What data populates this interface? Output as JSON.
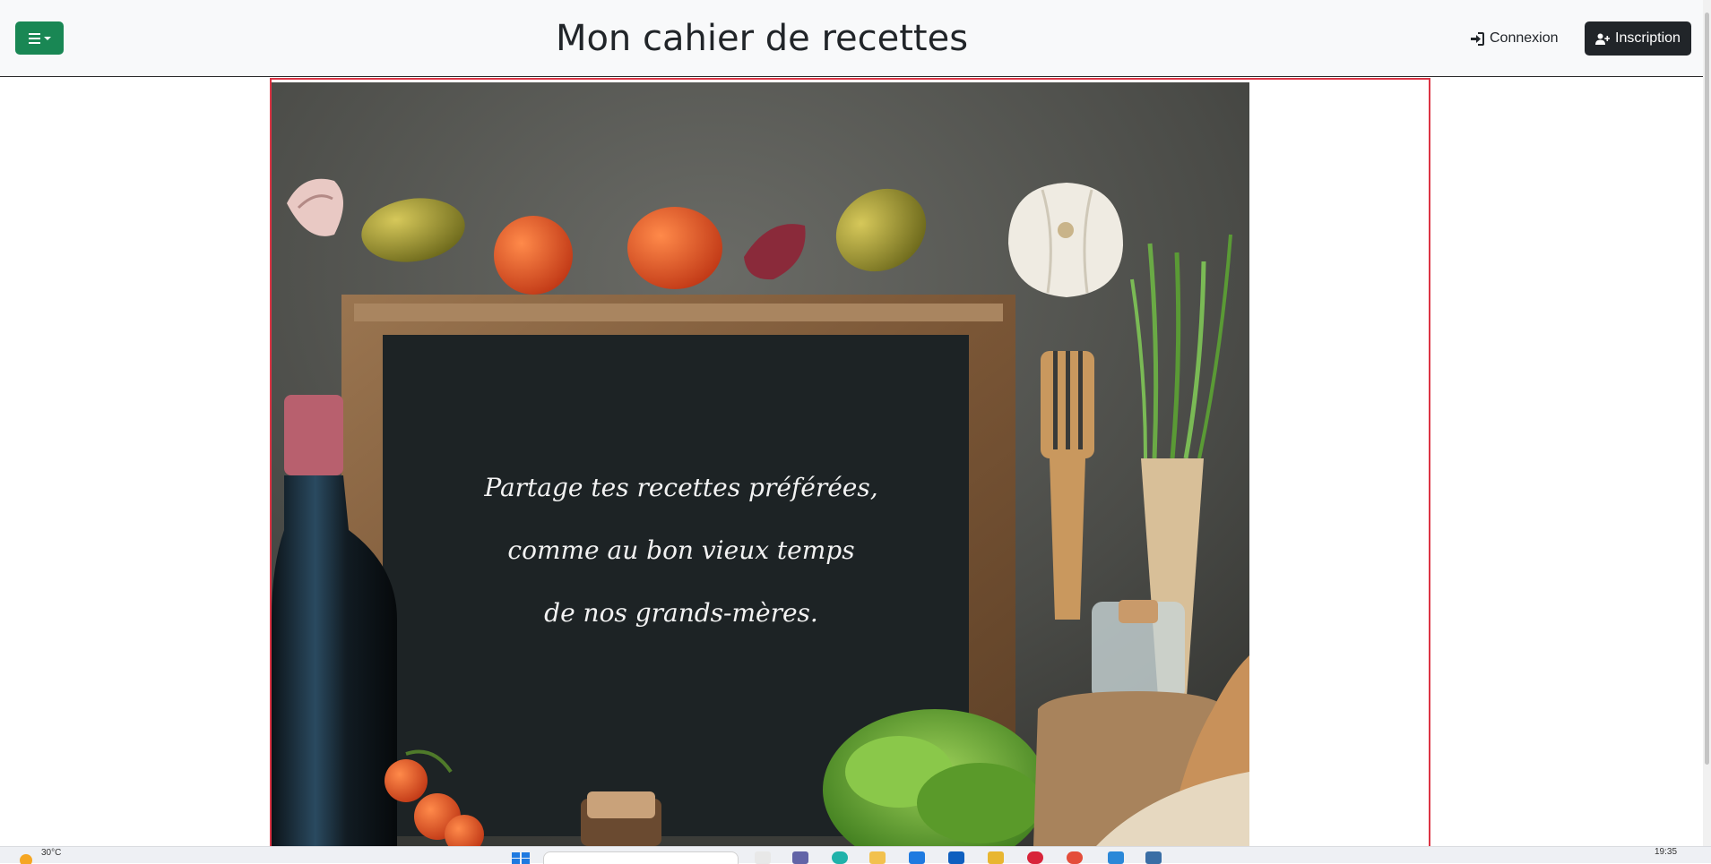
{
  "navbar": {
    "title": "Mon cahier de recettes",
    "menu_button_icon": "hamburger-icon",
    "login_label": "Connexion",
    "login_icon": "sign-in-icon",
    "signup_label": "Inscription",
    "signup_icon": "user-plus-icon",
    "menu_color": "#198754",
    "signup_color": "#212529"
  },
  "hero": {
    "lines": [
      "Partage tes recettes préférées,",
      "comme au bon vieux temps",
      "de nos grands-mères."
    ],
    "frame_color": "#dc3545"
  },
  "taskbar": {
    "temperature": "30°C",
    "time": "19:35"
  }
}
